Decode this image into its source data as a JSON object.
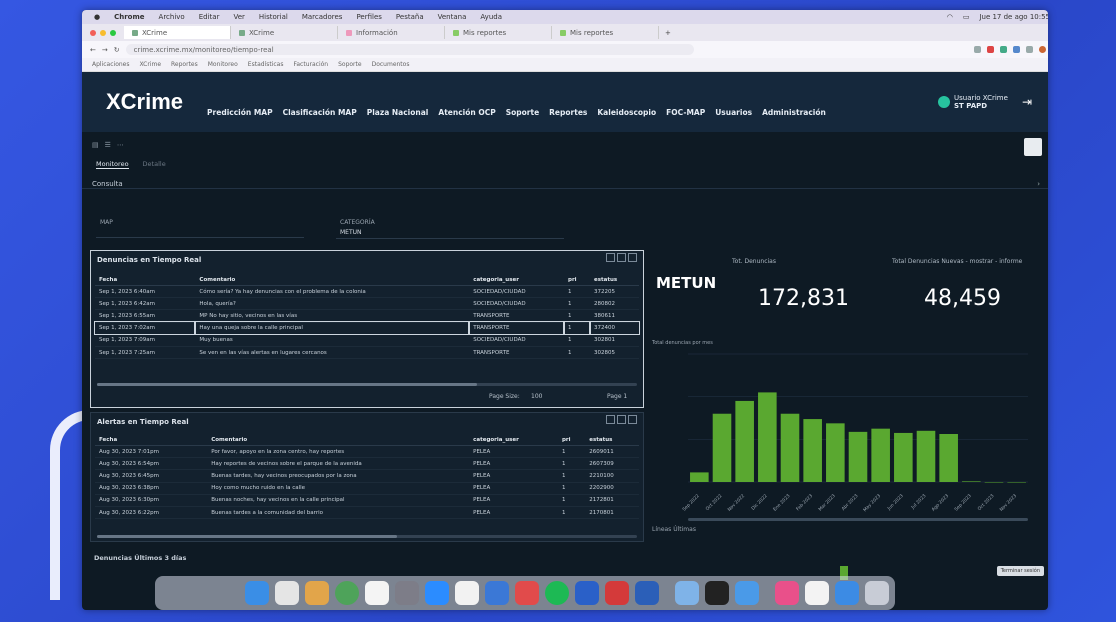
{
  "mac": {
    "menu": [
      "Chrome",
      "Archivo",
      "Editar",
      "Ver",
      "Historial",
      "Marcadores",
      "Perfiles",
      "Pestaña",
      "Ventana",
      "Ayuda"
    ],
    "status": "Jue 17 de ago 10:55"
  },
  "browser": {
    "tabs": [
      "XCrime",
      "XCrime",
      "Información",
      "Mis reportes",
      "Mis reportes"
    ],
    "address": "crime.xcrime.mx/monitoreo/tiempo-real",
    "bookmarks": [
      "Aplicaciones",
      "XCrime",
      "Reportes",
      "Monitoreo",
      "Estadísticas",
      "Facturación",
      "Soporte",
      "Documentos"
    ]
  },
  "app": {
    "logo": "XCrime",
    "nav": [
      "Predicción MAP",
      "Clasificación MAP",
      "Plaza Nacional",
      "Atención OCP",
      "Soporte",
      "Reportes",
      "Kaleidoscopio",
      "FOC-MAP",
      "Usuarios",
      "Administración"
    ],
    "user_name": "Usuario XCrime",
    "user_role": "ST PAPD"
  },
  "page": {
    "tab_active": "Monitoreo",
    "tab_inactive": "Detalle",
    "section": "Consulta",
    "filter_left_label": "MAP",
    "filter_right_label": "CATEGORÍA",
    "filter_right_value": "METUN"
  },
  "panel1": {
    "title": "Denuncias en Tiempo Real",
    "columns": [
      "Fecha",
      "Comentario",
      "categoria_user",
      "pri",
      "estatus"
    ],
    "rows": [
      [
        "Sep 1, 2023 6:40am",
        "Cómo sería? Ya hay denuncias con el problema de la colonia",
        "SOCIEDAD/CIUDAD",
        "1",
        "372205"
      ],
      [
        "Sep 1, 2023 6:42am",
        "Hola, quería?",
        "SOCIEDAD/CIUDAD",
        "1",
        "280802"
      ],
      [
        "Sep 1, 2023 6:55am",
        "MP No hay sitio, vecinos en las vías",
        "TRANSPORTE",
        "1",
        "380611"
      ],
      [
        "Sep 1, 2023 7:02am",
        "Hay una queja sobre la calle principal",
        "TRANSPORTE",
        "1",
        "372400"
      ],
      [
        "Sep 1, 2023 7:09am",
        "Muy buenas",
        "SOCIEDAD/CIUDAD",
        "1",
        "302801"
      ],
      [
        "Sep 1, 2023 7:25am",
        "Se ven en las vías alertas en lugares cercanos",
        "TRANSPORTE",
        "1",
        "302805"
      ]
    ],
    "pager": "Page Size:",
    "page_size": "100",
    "page": "Page 1"
  },
  "panel2": {
    "title": "Alertas en Tiempo Real",
    "columns": [
      "Fecha",
      "Comentario",
      "categoria_user",
      "pri",
      "estatus"
    ],
    "rows": [
      [
        "Aug 30, 2023 7:01pm",
        "Por favor, apoyo en la zona centro, hay reportes",
        "PELEA",
        "1",
        "2609011"
      ],
      [
        "Aug 30, 2023 6:54pm",
        "Hay reportes de vecinos sobre el parque de la avenida",
        "PELEA",
        "1",
        "2607309"
      ],
      [
        "Aug 30, 2023 6:45pm",
        "Buenas tardes, hay vecinos preocupados por la zona",
        "PELEA",
        "1",
        "2210100"
      ],
      [
        "Aug 30, 2023 6:38pm",
        "Hoy como mucho ruido en la calle",
        "PELEA",
        "1",
        "2202900"
      ],
      [
        "Aug 30, 2023 6:30pm",
        "Buenas noches, hay vecinos en la calle principal",
        "PELEA",
        "1",
        "2172801"
      ],
      [
        "Aug 30, 2023 6:22pm",
        "Buenas tardes a la comunidad del barrio",
        "PELEA",
        "1",
        "2170801"
      ]
    ],
    "bottom_title": "Denuncias Últimos 3 días"
  },
  "metrics": {
    "label1": "Tot. Denuncias",
    "label2": "Total Denuncias Nuevas - mostrar - informe",
    "metun": "METUN",
    "value1": "172,831",
    "value2": "48,459"
  },
  "chart_data": {
    "type": "bar",
    "title": "Total denuncias por mes",
    "categories": [
      "Sep 2022",
      "Oct 2022",
      "Nov 2022",
      "Dic 2022",
      "Ene 2023",
      "Feb 2023",
      "Mar 2023",
      "Abr 2023",
      "May 2023",
      "Jun 2023",
      "Jul 2023",
      "Ago 2023",
      "Sep 2023",
      "Oct 2023",
      "Nov 2023"
    ],
    "values": [
      900,
      6400,
      7600,
      8400,
      6400,
      5900,
      5500,
      4700,
      5000,
      4600,
      4800,
      4500,
      60,
      0,
      0
    ],
    "ylim": [
      0,
      12000
    ],
    "color": "#5aa830"
  },
  "bottom_chart": {
    "label": "Líneas Últimas"
  },
  "corner_badge": "Terminar sesión"
}
